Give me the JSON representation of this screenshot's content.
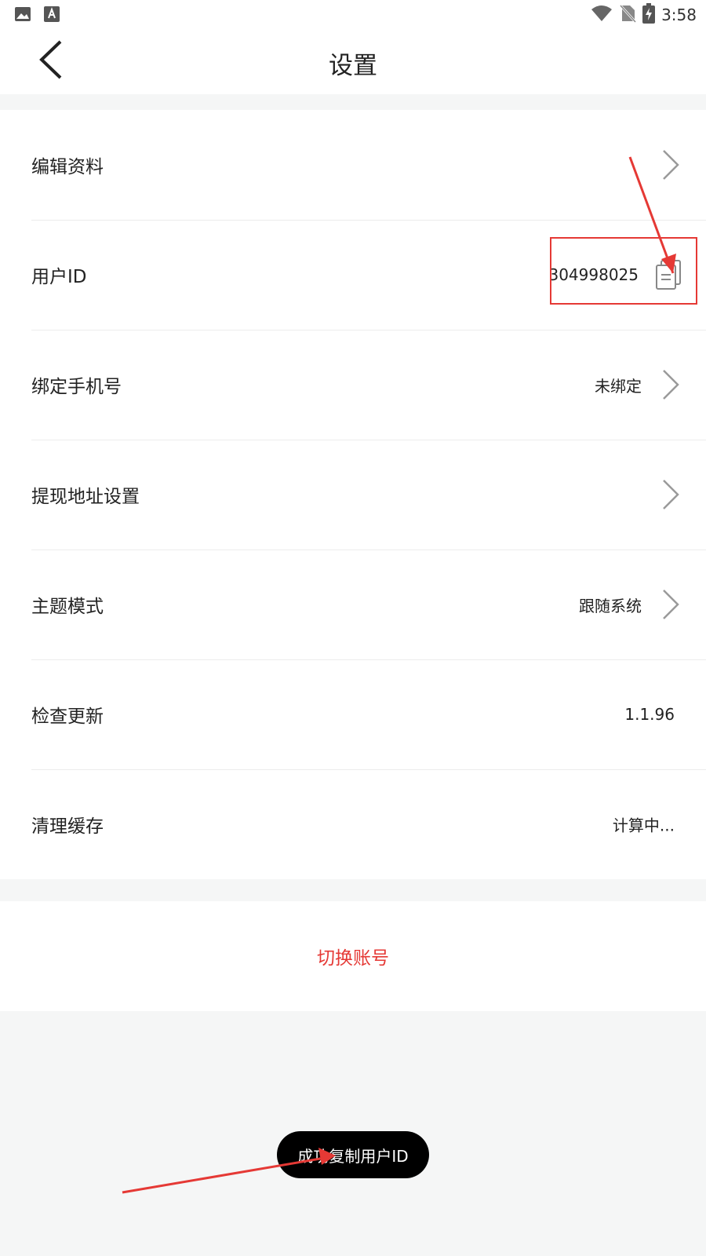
{
  "status_bar": {
    "time": "3:58",
    "left_icons": [
      "image-icon",
      "font-icon"
    ],
    "right_icons": [
      "wifi-icon",
      "no-sim-icon",
      "battery-charging-icon"
    ]
  },
  "header": {
    "title": "设置",
    "back_icon": "chevron-left-icon"
  },
  "settings": {
    "edit_profile": {
      "label": "编辑资料"
    },
    "user_id": {
      "label": "用户ID",
      "value": "304998025"
    },
    "bind_phone": {
      "label": "绑定手机号",
      "value": "未绑定"
    },
    "withdraw_address": {
      "label": "提现地址设置"
    },
    "theme_mode": {
      "label": "主题模式",
      "value": "跟随系统"
    },
    "check_update": {
      "label": "检查更新",
      "value": "1.1.96"
    },
    "clear_cache": {
      "label": "清理缓存",
      "value": "计算中..."
    }
  },
  "actions": {
    "switch_account": "切换账号"
  },
  "toast": {
    "message": "成功复制用户ID"
  },
  "colors": {
    "accent_red": "#e53935",
    "background": "#f5f6f6",
    "card": "#ffffff",
    "chevron": "#9a9a9a"
  }
}
